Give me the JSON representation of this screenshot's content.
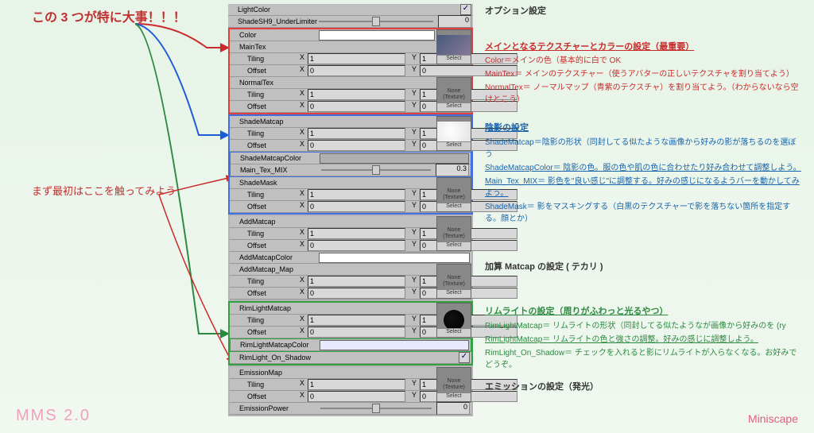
{
  "annotations": {
    "top_left_title": "この 3 つが特に大事！！！",
    "mid_left_note": "まず最初はここを触ってみよう"
  },
  "panel": {
    "lightcolor": {
      "label": "LightColor",
      "checked": true
    },
    "shadesh9": {
      "label": "ShadeSH9_UnderLimiter",
      "value": "0"
    },
    "color": {
      "label": "Color"
    },
    "maintex": {
      "label": "MainTex",
      "tiling_x": "1",
      "tiling_y": "1",
      "offset_x": "0",
      "offset_y": "0"
    },
    "normaltex": {
      "label": "NormalTex",
      "tiling_x": "1",
      "tiling_y": "1",
      "offset_x": "0",
      "offset_y": "0"
    },
    "shadematcap": {
      "label": "ShadeMatcap",
      "tiling_x": "1",
      "tiling_y": "1",
      "offset_x": "0",
      "offset_y": "0"
    },
    "shadematcapcolor": {
      "label": "ShadeMatcapColor"
    },
    "maintexmix": {
      "label": "Main_Tex_MIX",
      "value": "0.3"
    },
    "shademask": {
      "label": "ShadeMask",
      "tiling_x": "1",
      "tiling_y": "1",
      "offset_x": "0",
      "offset_y": "0"
    },
    "addmatcap": {
      "label": "AddMatcap",
      "tiling_x": "1",
      "tiling_y": "1",
      "offset_x": "0",
      "offset_y": "0"
    },
    "addmatcapcolor": {
      "label": "AddMatcapColor"
    },
    "addmatcapmap": {
      "label": "AddMatcap_Map",
      "tiling_x": "1",
      "tiling_y": "1",
      "offset_x": "0",
      "offset_y": "0"
    },
    "rimlightmatcap": {
      "label": "RimLightMatcap",
      "tiling_x": "1",
      "tiling_y": "1",
      "offset_x": "0",
      "offset_y": "0"
    },
    "rimlightmatcapcolor": {
      "label": "RimLightMatcapColor"
    },
    "rimlightonshadow": {
      "label": "RimLight_On_Shadow",
      "checked": true
    },
    "emissionmap": {
      "label": "EmissionMap",
      "tiling_x": "1",
      "tiling_y": "1",
      "offset_x": "0",
      "offset_y": "0"
    },
    "emissionpower": {
      "label": "EmissionPower",
      "value": "0"
    },
    "tiling": "Tiling",
    "offset": "Offset",
    "x": "X",
    "y": "Y",
    "none": "None",
    "texture": "(Texture)",
    "select": "Select"
  },
  "right": {
    "option_heading": "オプション設定",
    "sec1_title": "メインとなるテクスチャーとカラーの設定（最重要）",
    "sec1_l1": "Color＝メインの色（基本的に白で OK",
    "sec1_l2": "MainTex＝ メインのテクスチャー（使うアバターの正しいテクスチャを割り当てよう）",
    "sec1_l3": "NormalTex＝ ノーマルマップ（青紫のテクスチャ）を割り当てよう。（わからないなら空けとこう）",
    "sec2_title": "陰影の設定",
    "sec2_l1": "ShadeMatcap＝陰影の形状（同封してる似たような画像から好みの影が落ちるのを選ぼう",
    "sec2_l2": "ShadeMatcapColor＝ 陰影の色。服の色や肌の色に合わせたり好み合わせて調整しよう。",
    "sec2_l3": "Main_Tex_MIX＝ 影色を\"良い感じ\"に調整する。好みの感じになるようバーを動かしてみよう。",
    "sec2_l4": "ShadeMask＝ 影をマスキングする（白黒のテクスチャーで影を落ちない箇所を指定する。顔とか）",
    "sec3_title": "加算 Matcap の設定 ( テカリ )",
    "sec4_title": "リムライトの設定（周りがふわっと光るやつ）",
    "sec4_l1": "RimLightMatcap＝ リムライトの形状（同封してる似たようなが画像から好みのを (ry",
    "sec4_l2": "RimLightMatcap＝ リムライトの色と強さの調整。好みの感じに調整しよう。",
    "sec4_l3": "RimLight_On_Shadow＝ チェックを入れると影にリムライトが入らなくなる。お好みでどうぞ。",
    "sec5_title": "エミッションの設定（発光）"
  },
  "footer": {
    "left": "MMS 2.0",
    "right": "Miniscape"
  }
}
